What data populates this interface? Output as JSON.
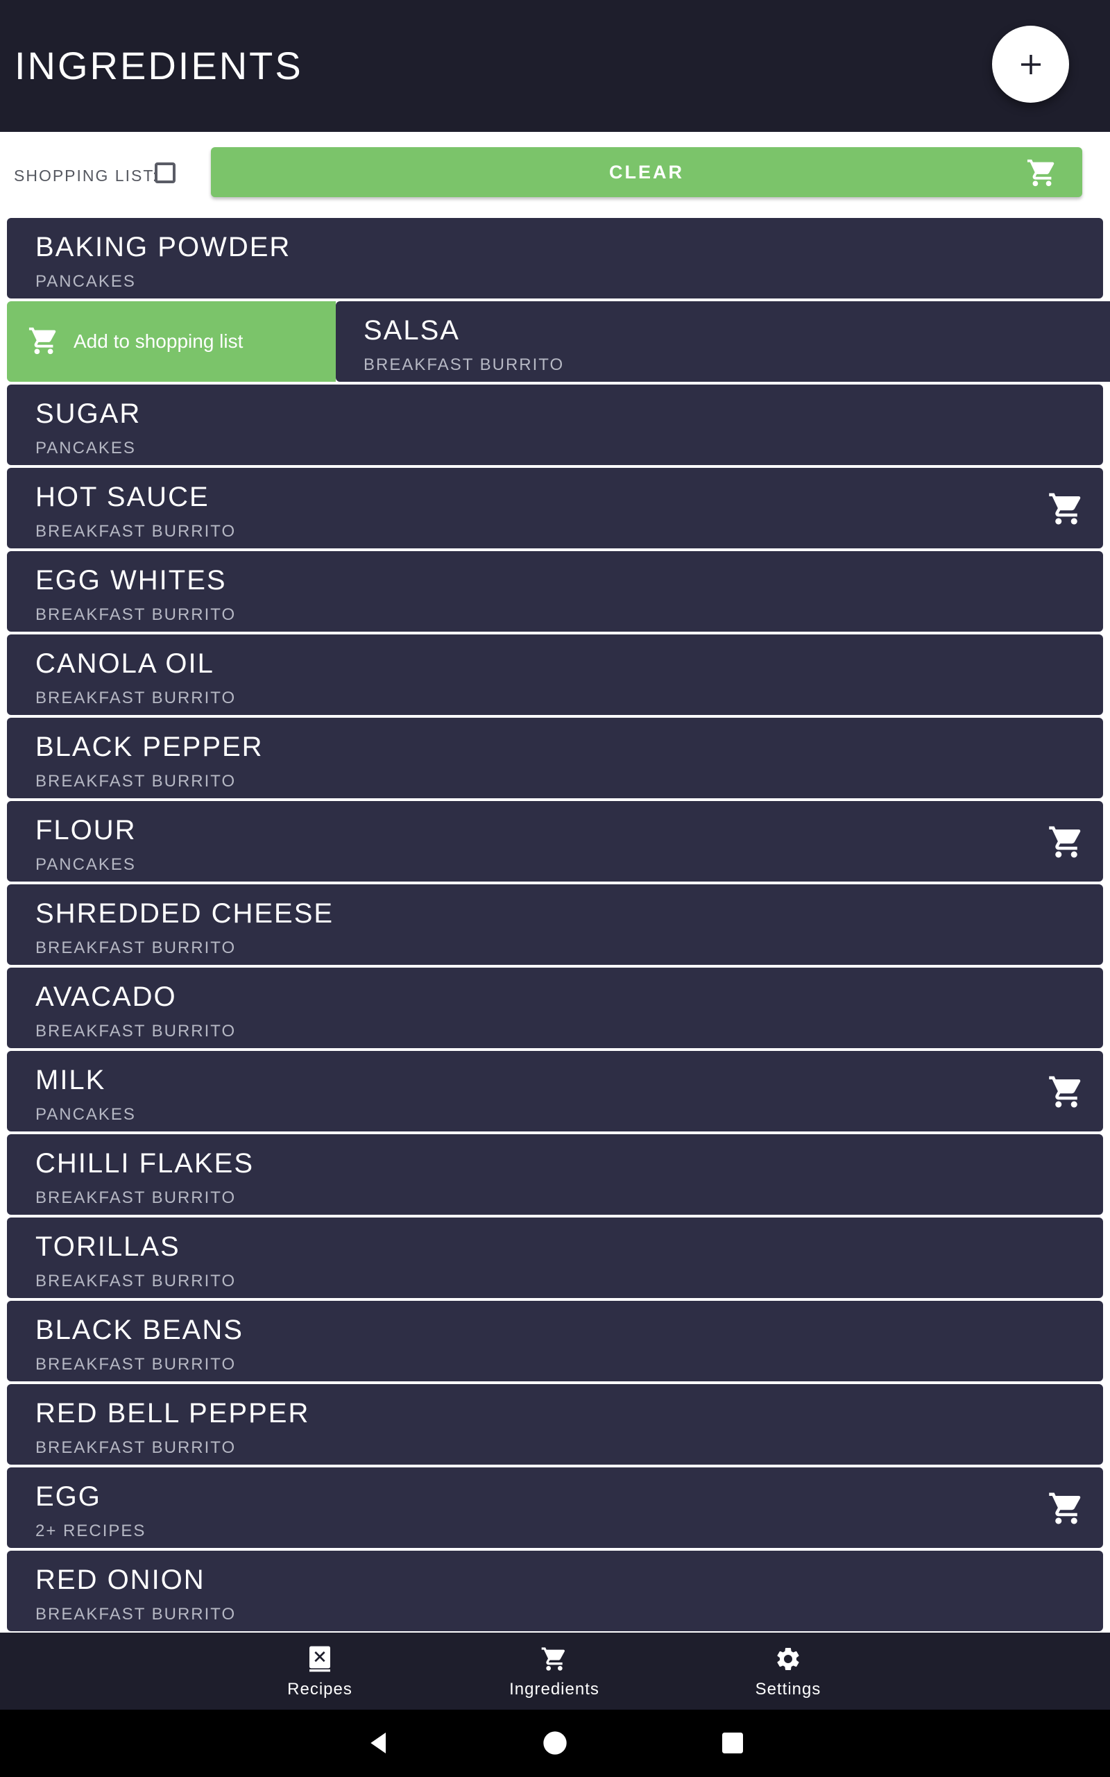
{
  "appbar": {
    "title": "INGREDIENTS",
    "fab_icon": "plus-icon"
  },
  "toolbar": {
    "shopping_label": "SHOPPING LIST:",
    "shopping_checked": false,
    "clear_label": "CLEAR"
  },
  "swipe": {
    "action_label": "Add to shopping list"
  },
  "ingredients": [
    {
      "name": "BAKING POWDER",
      "recipe": "PANCAKES",
      "in_cart": false
    },
    {
      "name": "SALSA",
      "recipe": "BREAKFAST BURRITO",
      "in_cart": false,
      "swiped": true
    },
    {
      "name": "SUGAR",
      "recipe": "PANCAKES",
      "in_cart": false
    },
    {
      "name": "HOT SAUCE",
      "recipe": "BREAKFAST BURRITO",
      "in_cart": true
    },
    {
      "name": "EGG WHITES",
      "recipe": "BREAKFAST BURRITO",
      "in_cart": false
    },
    {
      "name": "CANOLA OIL",
      "recipe": "BREAKFAST BURRITO",
      "in_cart": false
    },
    {
      "name": "BLACK PEPPER",
      "recipe": "BREAKFAST BURRITO",
      "in_cart": false
    },
    {
      "name": "FLOUR",
      "recipe": "PANCAKES",
      "in_cart": true
    },
    {
      "name": "SHREDDED CHEESE",
      "recipe": "BREAKFAST BURRITO",
      "in_cart": false
    },
    {
      "name": "AVACADO",
      "recipe": "BREAKFAST BURRITO",
      "in_cart": false
    },
    {
      "name": "MILK",
      "recipe": "PANCAKES",
      "in_cart": true
    },
    {
      "name": "CHILLI FLAKES",
      "recipe": "BREAKFAST BURRITO",
      "in_cart": false
    },
    {
      "name": "TORILLAS",
      "recipe": "BREAKFAST BURRITO",
      "in_cart": false
    },
    {
      "name": "BLACK BEANS",
      "recipe": "BREAKFAST BURRITO",
      "in_cart": false
    },
    {
      "name": "RED BELL PEPPER",
      "recipe": "BREAKFAST BURRITO",
      "in_cart": false
    },
    {
      "name": "EGG",
      "recipe": "2+ RECIPES",
      "in_cart": true
    },
    {
      "name": "RED ONION",
      "recipe": "BREAKFAST BURRITO",
      "in_cart": false
    }
  ],
  "bottom_nav": [
    {
      "label": "Recipes",
      "icon": "recipe-book-icon"
    },
    {
      "label": "Ingredients",
      "icon": "cart-icon"
    },
    {
      "label": "Settings",
      "icon": "gear-icon"
    }
  ],
  "colors": {
    "appbar": "#1e1e2c",
    "row": "#2e2e45",
    "accent_green": "#7bc46a"
  }
}
